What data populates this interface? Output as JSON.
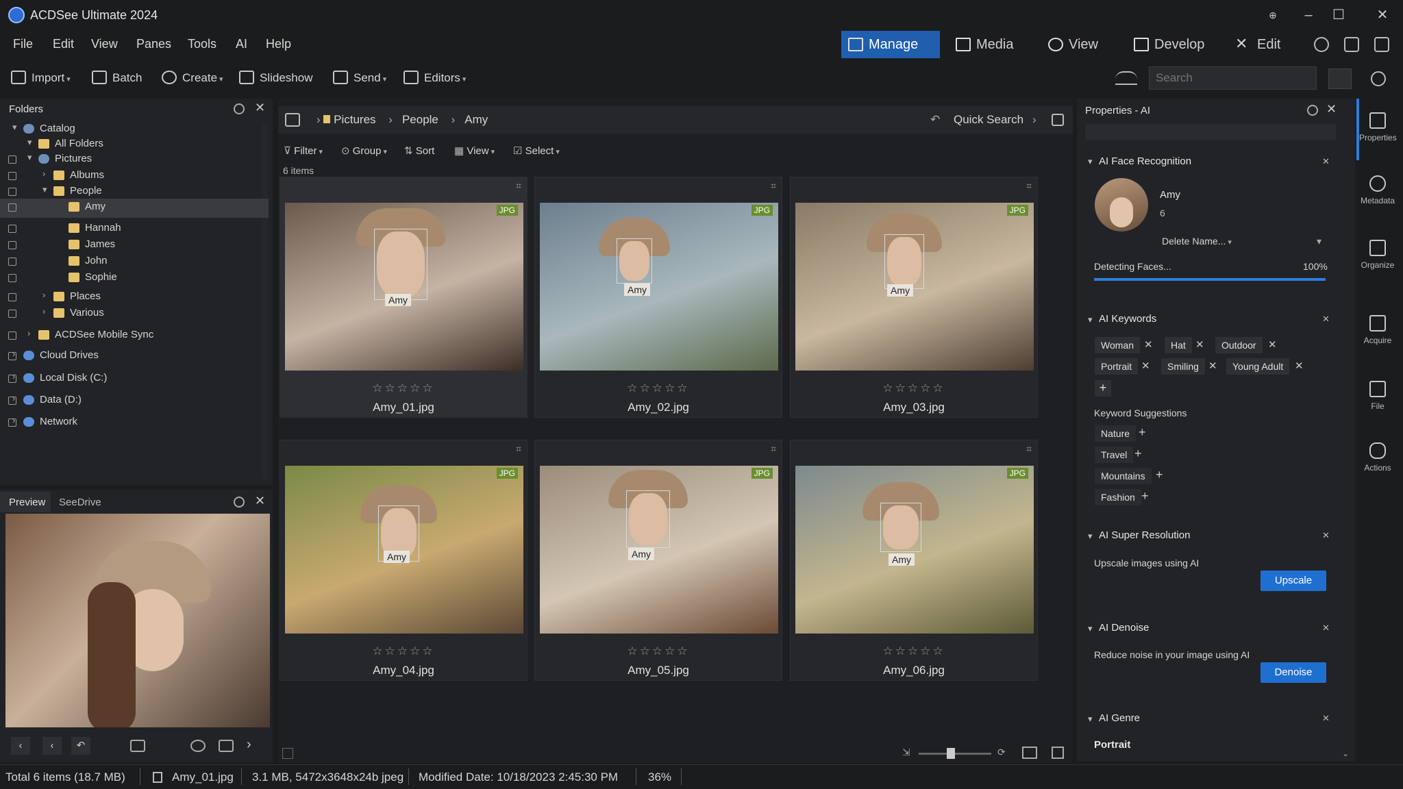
{
  "app": {
    "title": "ACDSee Ultimate 2024"
  },
  "menu": [
    "File",
    "Edit",
    "View",
    "Panes",
    "Tools",
    "AI",
    "Help"
  ],
  "modes": [
    {
      "label": "Manage",
      "active": true
    },
    {
      "label": "Media"
    },
    {
      "label": "View"
    },
    {
      "label": "Develop"
    },
    {
      "label": "Edit"
    }
  ],
  "toolbar": {
    "import": "Import",
    "batch": "Batch",
    "create": "Create",
    "slideshow": "Slideshow",
    "send": "Send",
    "editors": "Editors",
    "search_placeholder": "Search"
  },
  "folders": {
    "title": "Folders",
    "items": [
      {
        "label": "Catalog",
        "level": 0,
        "icon": "catalog"
      },
      {
        "label": "All Folders",
        "level": 1,
        "icon": "folder"
      },
      {
        "label": "Pictures",
        "level": 1,
        "icon": "pictures"
      },
      {
        "label": "Albums",
        "level": 2,
        "icon": "folder"
      },
      {
        "label": "People",
        "level": 2,
        "icon": "folder"
      },
      {
        "label": "Amy",
        "level": 3,
        "icon": "folder",
        "selected": true
      },
      {
        "label": "Hannah",
        "level": 3,
        "icon": "folder"
      },
      {
        "label": "James",
        "level": 3,
        "icon": "folder"
      },
      {
        "label": "John",
        "level": 3,
        "icon": "folder"
      },
      {
        "label": "Sophie",
        "level": 3,
        "icon": "folder"
      },
      {
        "label": "Places",
        "level": 2,
        "icon": "folder"
      },
      {
        "label": "Various",
        "level": 2,
        "icon": "folder"
      },
      {
        "label": "ACDSee Mobile Sync",
        "level": 1,
        "icon": "folder"
      },
      {
        "label": "Cloud Drives",
        "level": 0,
        "icon": "cloud"
      },
      {
        "label": "Local Disk (C:)",
        "level": 0,
        "icon": "disk"
      },
      {
        "label": "Data (D:)",
        "level": 0,
        "icon": "disk"
      },
      {
        "label": "Network",
        "level": 0,
        "icon": "network"
      }
    ]
  },
  "preview_tabs": [
    "Preview",
    "SeeDrive"
  ],
  "breadcrumb": [
    "Pictures",
    "People",
    "Amy"
  ],
  "quick_search": "Quick Search",
  "filterbar": {
    "filter": "Filter",
    "group": "Group",
    "sort": "Sort",
    "view": "View",
    "select": "Select"
  },
  "item_count": "6 items",
  "files": [
    {
      "name": "Amy_01.jpg",
      "tag": "Amy",
      "badge": "JPG",
      "stars": "☆☆☆☆☆",
      "colors": [
        "#6b5a4d",
        "#c5b4a4",
        "#3d2e25"
      ]
    },
    {
      "name": "Amy_02.jpg",
      "tag": "Amy",
      "badge": "JPG",
      "stars": "☆☆☆☆☆",
      "colors": [
        "#6d7f8e",
        "#a8b8bd",
        "#5c6a4a"
      ]
    },
    {
      "name": "Amy_03.jpg",
      "tag": "Amy",
      "badge": "JPG",
      "stars": "☆☆☆☆☆",
      "colors": [
        "#8a7a66",
        "#c9b89f",
        "#4d3e32"
      ]
    },
    {
      "name": "Amy_04.jpg",
      "tag": "Amy",
      "badge": "JPG",
      "stars": "☆☆☆☆☆",
      "colors": [
        "#7a8a45",
        "#c9a970",
        "#5b4936"
      ]
    },
    {
      "name": "Amy_05.jpg",
      "tag": "Amy",
      "badge": "JPG",
      "stars": "☆☆☆☆☆",
      "colors": [
        "#9b8c7c",
        "#d3c6b3",
        "#6b4a35"
      ]
    },
    {
      "name": "Amy_06.jpg",
      "tag": "Amy",
      "badge": "JPG",
      "stars": "☆☆☆☆☆",
      "colors": [
        "#7d8a8e",
        "#c3b68e",
        "#5d5a38"
      ]
    }
  ],
  "properties": {
    "title": "Properties - AI",
    "face": {
      "title": "AI Face Recognition",
      "name": "Amy",
      "count": "6",
      "dropdown": "Delete Name...",
      "status": "Detecting Faces...",
      "percent": "100%",
      "progress": 1.0
    },
    "keywords": {
      "title": "AI Keywords",
      "tags": [
        "Woman",
        "Hat",
        "Outdoor",
        "Portrait",
        "Smiling",
        "Young Adult"
      ],
      "suggestions_label": "Keyword Suggestions",
      "suggestions": [
        "Nature",
        "Travel",
        "Mountains",
        "Fashion"
      ]
    },
    "super_res": {
      "title": "AI Super Resolution",
      "desc": "Upscale images using AI",
      "button": "Upscale"
    },
    "denoise": {
      "title": "AI Denoise",
      "desc": "Reduce noise in your image using AI",
      "button": "Denoise"
    },
    "genre": {
      "title": "AI Genre",
      "value": "Portrait"
    }
  },
  "right_tabs": [
    "Properties",
    "Metadata",
    "Organize",
    "Acquire",
    "File",
    "Actions"
  ],
  "status": {
    "total": "Total 6 items (18.7 MB)",
    "file": "Amy_01.jpg",
    "info": "3.1 MB, 5472x3648x24b jpeg",
    "modified": "Modified Date: 10/18/2023 2:45:30 PM",
    "zoom": "36%"
  },
  "colors": {
    "accent": "#1f5fae",
    "button": "#1f6fd1",
    "progress": "#2f7ddd"
  }
}
